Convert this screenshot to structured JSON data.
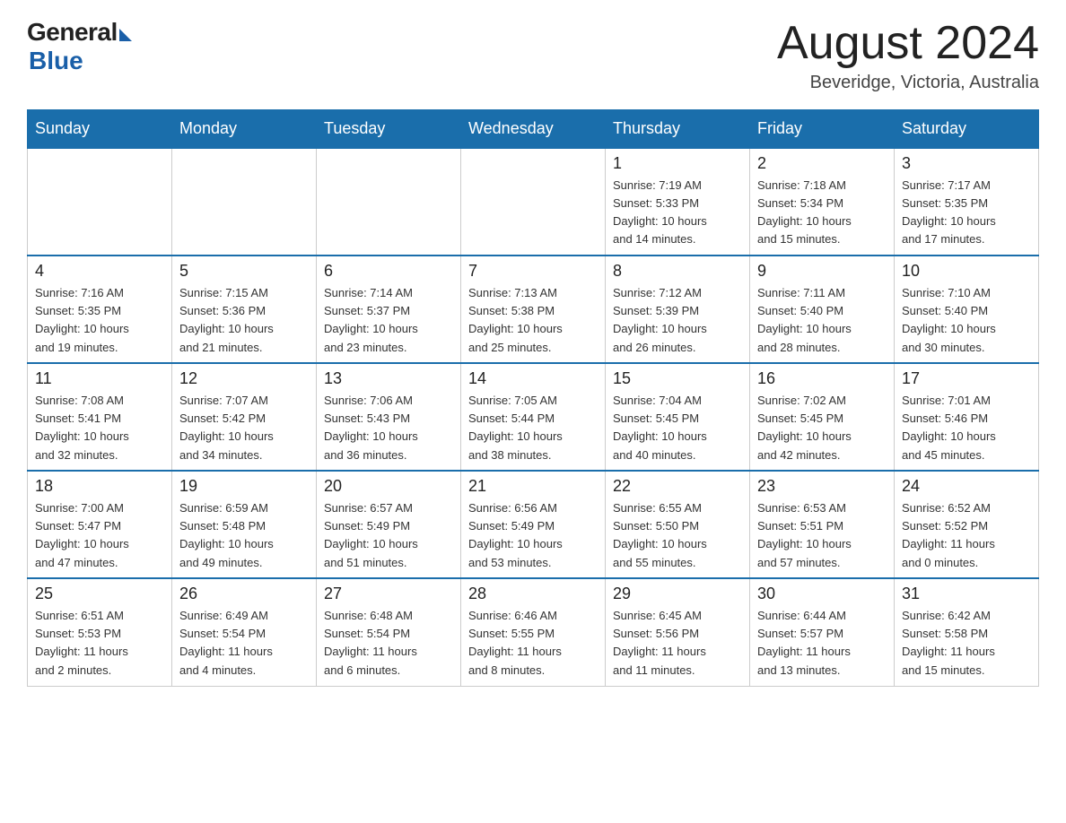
{
  "logo": {
    "general": "General",
    "blue": "Blue",
    "tagline": "Blue"
  },
  "header": {
    "month": "August 2024",
    "location": "Beveridge, Victoria, Australia"
  },
  "weekdays": [
    "Sunday",
    "Monday",
    "Tuesday",
    "Wednesday",
    "Thursday",
    "Friday",
    "Saturday"
  ],
  "rows": [
    [
      {
        "day": "",
        "info": ""
      },
      {
        "day": "",
        "info": ""
      },
      {
        "day": "",
        "info": ""
      },
      {
        "day": "",
        "info": ""
      },
      {
        "day": "1",
        "info": "Sunrise: 7:19 AM\nSunset: 5:33 PM\nDaylight: 10 hours\nand 14 minutes."
      },
      {
        "day": "2",
        "info": "Sunrise: 7:18 AM\nSunset: 5:34 PM\nDaylight: 10 hours\nand 15 minutes."
      },
      {
        "day": "3",
        "info": "Sunrise: 7:17 AM\nSunset: 5:35 PM\nDaylight: 10 hours\nand 17 minutes."
      }
    ],
    [
      {
        "day": "4",
        "info": "Sunrise: 7:16 AM\nSunset: 5:35 PM\nDaylight: 10 hours\nand 19 minutes."
      },
      {
        "day": "5",
        "info": "Sunrise: 7:15 AM\nSunset: 5:36 PM\nDaylight: 10 hours\nand 21 minutes."
      },
      {
        "day": "6",
        "info": "Sunrise: 7:14 AM\nSunset: 5:37 PM\nDaylight: 10 hours\nand 23 minutes."
      },
      {
        "day": "7",
        "info": "Sunrise: 7:13 AM\nSunset: 5:38 PM\nDaylight: 10 hours\nand 25 minutes."
      },
      {
        "day": "8",
        "info": "Sunrise: 7:12 AM\nSunset: 5:39 PM\nDaylight: 10 hours\nand 26 minutes."
      },
      {
        "day": "9",
        "info": "Sunrise: 7:11 AM\nSunset: 5:40 PM\nDaylight: 10 hours\nand 28 minutes."
      },
      {
        "day": "10",
        "info": "Sunrise: 7:10 AM\nSunset: 5:40 PM\nDaylight: 10 hours\nand 30 minutes."
      }
    ],
    [
      {
        "day": "11",
        "info": "Sunrise: 7:08 AM\nSunset: 5:41 PM\nDaylight: 10 hours\nand 32 minutes."
      },
      {
        "day": "12",
        "info": "Sunrise: 7:07 AM\nSunset: 5:42 PM\nDaylight: 10 hours\nand 34 minutes."
      },
      {
        "day": "13",
        "info": "Sunrise: 7:06 AM\nSunset: 5:43 PM\nDaylight: 10 hours\nand 36 minutes."
      },
      {
        "day": "14",
        "info": "Sunrise: 7:05 AM\nSunset: 5:44 PM\nDaylight: 10 hours\nand 38 minutes."
      },
      {
        "day": "15",
        "info": "Sunrise: 7:04 AM\nSunset: 5:45 PM\nDaylight: 10 hours\nand 40 minutes."
      },
      {
        "day": "16",
        "info": "Sunrise: 7:02 AM\nSunset: 5:45 PM\nDaylight: 10 hours\nand 42 minutes."
      },
      {
        "day": "17",
        "info": "Sunrise: 7:01 AM\nSunset: 5:46 PM\nDaylight: 10 hours\nand 45 minutes."
      }
    ],
    [
      {
        "day": "18",
        "info": "Sunrise: 7:00 AM\nSunset: 5:47 PM\nDaylight: 10 hours\nand 47 minutes."
      },
      {
        "day": "19",
        "info": "Sunrise: 6:59 AM\nSunset: 5:48 PM\nDaylight: 10 hours\nand 49 minutes."
      },
      {
        "day": "20",
        "info": "Sunrise: 6:57 AM\nSunset: 5:49 PM\nDaylight: 10 hours\nand 51 minutes."
      },
      {
        "day": "21",
        "info": "Sunrise: 6:56 AM\nSunset: 5:49 PM\nDaylight: 10 hours\nand 53 minutes."
      },
      {
        "day": "22",
        "info": "Sunrise: 6:55 AM\nSunset: 5:50 PM\nDaylight: 10 hours\nand 55 minutes."
      },
      {
        "day": "23",
        "info": "Sunrise: 6:53 AM\nSunset: 5:51 PM\nDaylight: 10 hours\nand 57 minutes."
      },
      {
        "day": "24",
        "info": "Sunrise: 6:52 AM\nSunset: 5:52 PM\nDaylight: 11 hours\nand 0 minutes."
      }
    ],
    [
      {
        "day": "25",
        "info": "Sunrise: 6:51 AM\nSunset: 5:53 PM\nDaylight: 11 hours\nand 2 minutes."
      },
      {
        "day": "26",
        "info": "Sunrise: 6:49 AM\nSunset: 5:54 PM\nDaylight: 11 hours\nand 4 minutes."
      },
      {
        "day": "27",
        "info": "Sunrise: 6:48 AM\nSunset: 5:54 PM\nDaylight: 11 hours\nand 6 minutes."
      },
      {
        "day": "28",
        "info": "Sunrise: 6:46 AM\nSunset: 5:55 PM\nDaylight: 11 hours\nand 8 minutes."
      },
      {
        "day": "29",
        "info": "Sunrise: 6:45 AM\nSunset: 5:56 PM\nDaylight: 11 hours\nand 11 minutes."
      },
      {
        "day": "30",
        "info": "Sunrise: 6:44 AM\nSunset: 5:57 PM\nDaylight: 11 hours\nand 13 minutes."
      },
      {
        "day": "31",
        "info": "Sunrise: 6:42 AM\nSunset: 5:58 PM\nDaylight: 11 hours\nand 15 minutes."
      }
    ]
  ]
}
